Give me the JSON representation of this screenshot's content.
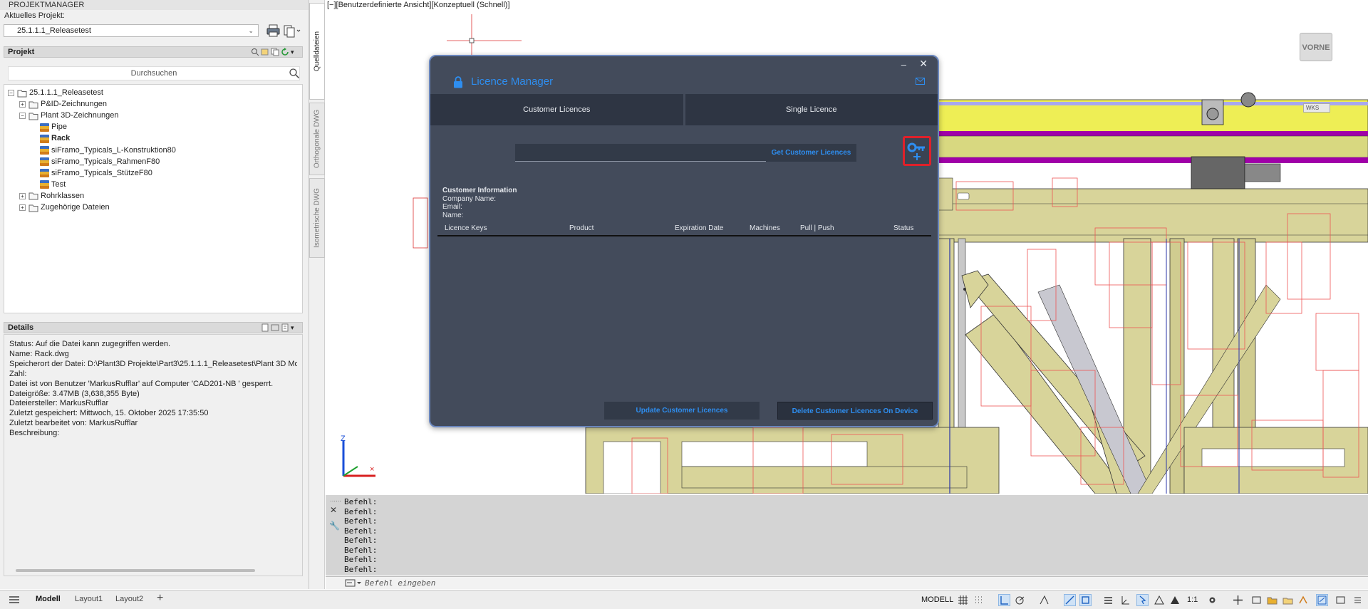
{
  "project_manager": {
    "title": "PROJEKTMANAGER",
    "current_project_label": "Aktuelles Projekt:",
    "current_project_value": "25.1.1.1_Releasetest",
    "project_panel_title": "Projekt",
    "search_placeholder": "Durchsuchen",
    "tree": [
      {
        "label": "25.1.1.1_Releasetest",
        "level": 0,
        "expander": "−",
        "icon": "project-icon"
      },
      {
        "label": "P&ID-Zeichnungen",
        "level": 1,
        "expander": "+",
        "icon": "pid-folder-icon"
      },
      {
        "label": "Plant 3D-Zeichnungen",
        "level": 1,
        "expander": "−",
        "icon": "plant3d-folder-icon"
      },
      {
        "label": "Pipe",
        "level": 2,
        "icon": "dwg-icon"
      },
      {
        "label": "Rack",
        "level": 2,
        "icon": "dwg-icon",
        "bold": true
      },
      {
        "label": "siFramo_Typicals_L-Konstruktion80",
        "level": 2,
        "icon": "dwg-icon"
      },
      {
        "label": "siFramo_Typicals_RahmenF80",
        "level": 2,
        "icon": "dwg-icon"
      },
      {
        "label": "siFramo_Typicals_StützeF80",
        "level": 2,
        "icon": "dwg-icon"
      },
      {
        "label": "Test",
        "level": 2,
        "icon": "dwg-icon"
      },
      {
        "label": "Rohrklassen",
        "level": 1,
        "expander": "+",
        "icon": "spec-folder-icon"
      },
      {
        "label": "Zugehörige Dateien",
        "level": 1,
        "expander": "+",
        "icon": "folder-icon"
      }
    ],
    "details_title": "Details",
    "details": [
      "Status: Auf die Datei kann zugegriffen werden.",
      "Name: Rack.dwg",
      "Speicherort der Datei: D:\\Plant3D Projekte\\Part3\\25.1.1.1_Releasetest\\Plant 3D Mo",
      "Zahl:",
      "Datei ist von Benutzer 'MarkusRufflar' auf Computer 'CAD201-NB ' gesperrt.",
      "Dateigröße: 3.47MB (3,638,355 Byte)",
      "Dateiersteller: MarkusRufflar",
      "Zuletzt gespeichert: Mittwoch, 15. Oktober 2025 17:35:50",
      "Zuletzt bearbeitet von: MarkusRufflar",
      "Beschreibung:"
    ]
  },
  "vertical_tabs": [
    "Quelldateien",
    "Orthogonale DWG",
    "Isometrische DWG"
  ],
  "viewport": {
    "view_label": "[−][Benutzerdefinierte Ansicht][Konzeptuell (Schnell)]",
    "viewcube_label": "VORNE",
    "wcs_label": "WKS"
  },
  "licence_manager": {
    "title": "Licence Manager",
    "tabs": [
      "Customer Licences",
      "Single Licence"
    ],
    "customer_id_value": "",
    "get_button": "Get Customer Licences",
    "info_heading": "Customer Information",
    "info_company": "Company Name:",
    "info_email": "Email:",
    "info_name": "Name:",
    "columns": [
      "Licence Keys",
      "Product",
      "Expiration Date",
      "Machines",
      "Pull | Push",
      "Status"
    ],
    "update_button": "Update Customer Licences",
    "delete_button": "Delete Customer Licences On Device",
    "accent_color": "#2e8ef0",
    "highlight_color": "#e0202a"
  },
  "command_line": {
    "history": [
      "Befehl:",
      "Befehl:",
      "Befehl:",
      "Befehl:",
      "Befehl:",
      "Befehl:",
      "Befehl:",
      "Befehl:"
    ],
    "placeholder": "Befehl eingeben"
  },
  "status_bar": {
    "layout_tabs": [
      "Modell",
      "Layout1",
      "Layout2"
    ],
    "model_label": "MODELL",
    "scale_label": "1:1"
  }
}
